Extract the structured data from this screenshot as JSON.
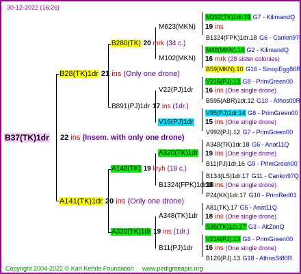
{
  "header": {
    "date": "30-12-2022 (16:26)"
  },
  "root": {
    "name": "B37(TK)1dr",
    "ins": "22",
    "ins_label": "ins",
    "note": "(Insem. with only one drone)"
  },
  "gen2": [
    {
      "name": "B28(TK)1dr",
      "ins": "21",
      "ins_label": "ins",
      "note": "(Only one drone)"
    },
    {
      "name": "A141(TK)1dr",
      "ins": "20",
      "ins_label": "ins",
      "note": "(Only one drone)"
    }
  ],
  "gen3": [
    {
      "name": "B280(TK)",
      "ins": "20",
      "ins_label": "mrk",
      "note": "(34 c.)"
    },
    {
      "name": "B891(PJ)1dr",
      "ins": "17",
      "ins_label": "ins",
      "note": "(1dr.)"
    },
    {
      "name": "A140(TK)",
      "ins": "19",
      "ins_label": "leyh",
      "note": "(18 c.)"
    },
    {
      "name": "A320(TK)1dr",
      "ins": "19",
      "ins_label": "ins",
      "note": "(1dr.)"
    }
  ],
  "gen4": [
    {
      "name": "M623(MKN)",
      "ins": "19",
      "ins_label": "ins",
      "note": ""
    },
    {
      "name": "M102(MKN)",
      "ins": "16",
      "ins_label": "mrk",
      "note": "(28 sister colonies)"
    },
    {
      "name": "V22(PJ)1dr",
      "ins": "16",
      "ins_label": "ins",
      "note": "(One single drone)"
    },
    {
      "name": "V16(PJ)1dr",
      "ins": "15",
      "ins_label": "ins",
      "note": "(One single drone)"
    },
    {
      "name": "A320(TK)1dr",
      "ins": "19",
      "ins_label": "ins",
      "note": "(One single drone)"
    },
    {
      "name": "B1324(FPK)1dr18",
      "ins": "18",
      "ins_label": "ins",
      "note": "(One single drone)"
    },
    {
      "name": "A348(TK)1dr",
      "ins": "18",
      "ins_label": "ins",
      "note": "(One single drone)"
    },
    {
      "name": "B11(PJ)1dr",
      "ins": "16",
      "ins_label": "ins",
      "note": "(One single drone)"
    }
  ],
  "gen5": [
    {
      "name": "M392(TK)1dr.19",
      "line": "G7 - KilimandQ"
    },
    {
      "name": "B1324(FPK)1dr.18",
      "line": "G6 - Cankiri97Q"
    },
    {
      "name": "M48(MKN).14",
      "line": "G2 - KilimandQ"
    },
    {
      "name": "B59(MKN).10",
      "line": "G16 - SinopEgg86R"
    },
    {
      "name": "V216(PJ).13",
      "line": "G8 - PrimGreen00"
    },
    {
      "name": "B595(ABR)1dr.12",
      "line": "G10 - Athos00R"
    },
    {
      "name": "V95(PJ)1dr.14",
      "line": "G8 - PrimGreen00"
    },
    {
      "name": "V992(PJ).12",
      "line": "G7 - PrimGreen00"
    },
    {
      "name": "A348(TK)1dr.18",
      "line": "G6 - Anat11Q"
    },
    {
      "name": "B11(PJ)1dr.16",
      "line": "G9 - PrimGreen00"
    },
    {
      "name": "B134(LS)1dr.17",
      "line": "G11 - Cankiri97Q"
    },
    {
      "name": "P24(KK)1dr.17",
      "line": "G10 - PrimRed01"
    },
    {
      "name": "A81(TK).17",
      "line": "G5 - Anat11Q"
    },
    {
      "name": "S35(TK)1dr.17",
      "line": "G3 - AltZonQ"
    },
    {
      "name": "V216(PJ).13",
      "line": "G8 - PrimGreen00"
    },
    {
      "name": "B126(PJ).13",
      "line": "G18 - AthosSt80R"
    }
  ],
  "footer": {
    "copyright": "Copyright 2004-2022 © Karl Kehrle Foundation",
    "url": "www.pedigreeapis.org"
  },
  "colors": {
    "border": "#990099",
    "pink": "#ffccff",
    "yellow": "#ffff00",
    "green": "#00ee00",
    "cyan": "#00e5ff"
  }
}
